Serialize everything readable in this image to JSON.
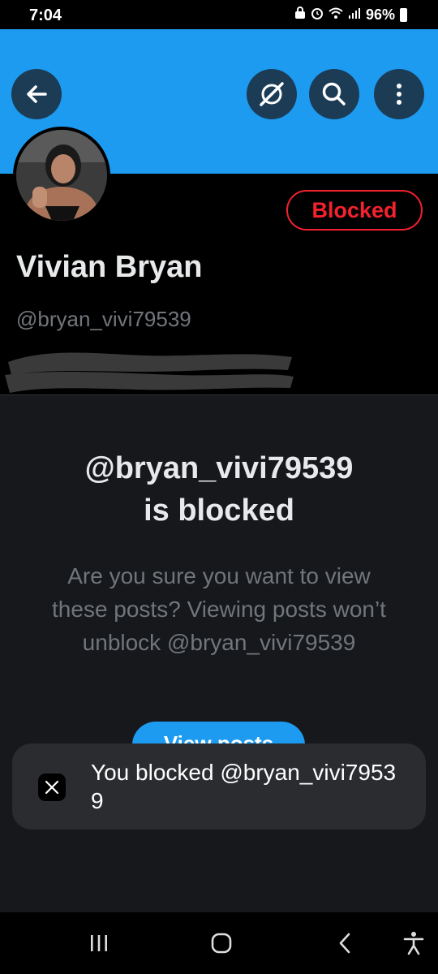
{
  "status_bar": {
    "time": "7:04",
    "battery": "96%",
    "icons": [
      "lock-icon",
      "alarm-icon",
      "wifi-icon",
      "signal-icon",
      "battery-icon"
    ]
  },
  "header": {
    "buttons": [
      "back-arrow-icon",
      "grok-icon",
      "search-icon",
      "more-vertical-icon"
    ],
    "banner_color": "#1d9bf0"
  },
  "profile": {
    "display_name": "Vivian Bryan",
    "handle": "@bryan_vivi79539",
    "blocked_label": "Blocked"
  },
  "blocked_notice": {
    "title_line1": "@bryan_vivi79539",
    "title_line2": "is blocked",
    "description": "Are you sure you want to view these posts? Viewing posts won’t unblock @bryan_vivi79539",
    "view_posts_label": "View posts"
  },
  "toast": {
    "message": "You blocked @bryan_vivi79539"
  },
  "nav": {
    "buttons": [
      "recents-icon",
      "home-icon",
      "back-icon",
      "accessibility-icon"
    ]
  },
  "colors": {
    "accent": "#1d9bf0",
    "danger": "#f4212e",
    "panel": "#16181c",
    "muted_text": "#71767b"
  }
}
